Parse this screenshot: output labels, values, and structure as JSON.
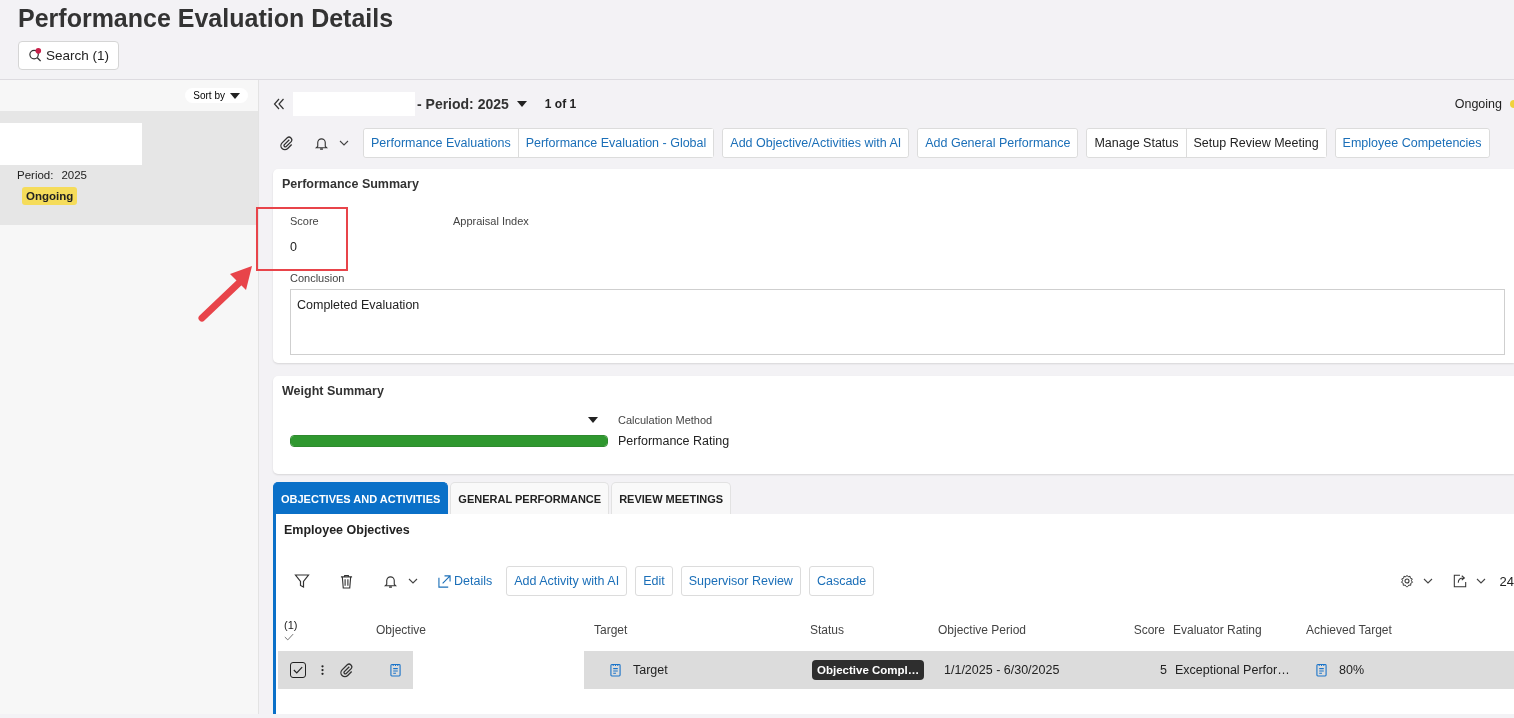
{
  "header": {
    "title": "Performance Evaluation Details",
    "search_button": "Search (1)"
  },
  "list_panel": {
    "sort_label": "Sort by",
    "items": [
      {
        "period_label": "Period:",
        "period": "2025",
        "status": "Ongoing",
        "selected": true
      }
    ]
  },
  "record": {
    "title": "- Period: 2025",
    "pager": "1 of 1",
    "status": "Ongoing"
  },
  "toolbar": {
    "groups": [
      [
        {
          "label": "Performance Evaluations",
          "kind": "link"
        },
        {
          "label": "Performance Evaluation - Global",
          "kind": "link"
        }
      ],
      [
        {
          "label": "Add Objective/Activities with AI",
          "kind": "link"
        }
      ],
      [
        {
          "label": "Add General Performance",
          "kind": "link"
        }
      ],
      [
        {
          "label": "Manage Status",
          "kind": "action"
        },
        {
          "label": "Setup Review Meeting",
          "kind": "action"
        }
      ],
      [
        {
          "label": "Employee Competencies",
          "kind": "link"
        }
      ]
    ]
  },
  "performance_summary": {
    "title": "Performance Summary",
    "fields": [
      {
        "label": "Score",
        "value": "0"
      },
      {
        "label": "Appraisal Index"
      }
    ],
    "conclusion_label": "Conclusion",
    "conclusion": "Completed Evaluation"
  },
  "weight_summary": {
    "title": "Weight Summary",
    "level": 1,
    "calculation_label": "Calculation Method",
    "calculation_value": "Performance Rating"
  },
  "tabs": [
    {
      "label": "OBJECTIVES AND ACTIVITIES",
      "selected": true
    },
    {
      "label": "GENERAL PERFORMANCE",
      "selected": false
    },
    {
      "label": "REVIEW MEETINGS",
      "selected": false
    }
  ],
  "objectives": {
    "title": "Employee Objectives",
    "actions": [
      {
        "label": "Details",
        "kind": "link"
      },
      {
        "label": "Add Activity with AI",
        "kind": "button"
      },
      {
        "label": "Edit",
        "kind": "button"
      },
      {
        "label": "Supervisor Review",
        "kind": "button"
      },
      {
        "label": "Cascade",
        "kind": "button"
      }
    ],
    "page_size": "24",
    "columns": [
      "(1)",
      "Objective",
      "Target",
      "Status",
      "Objective Period",
      "Score",
      "Evaluator Rating",
      "Achieved Target"
    ],
    "rows": [
      {
        "checked": true,
        "selected": true,
        "target": "Target",
        "status": "Objective Compl…",
        "period": "1/1/2025 - 6/30/2025",
        "score": "5",
        "rating": "Exceptional Perfor…",
        "achieved": "80%"
      }
    ]
  }
}
